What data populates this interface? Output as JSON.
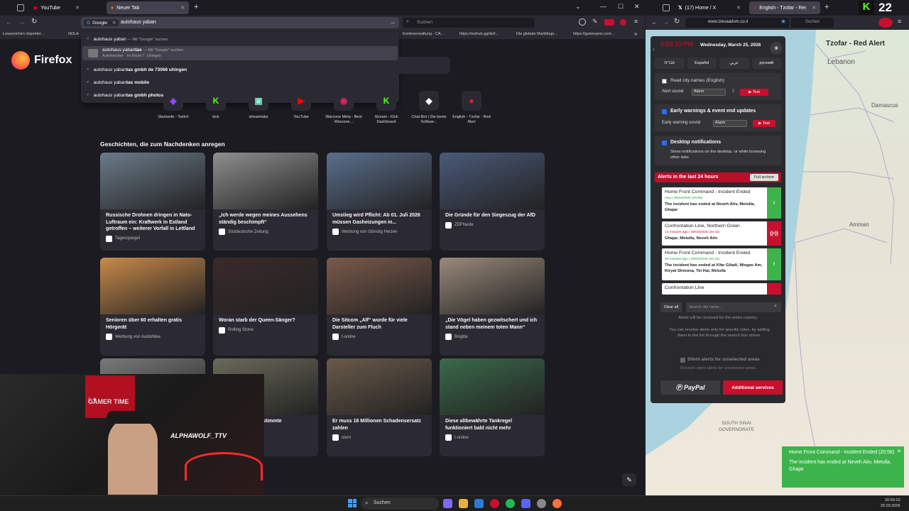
{
  "left_browser": {
    "tabs": [
      {
        "label": "YouTube",
        "icon": "youtube-icon"
      },
      {
        "label": "Neuer Tab",
        "icon": "firefox-tab-icon"
      }
    ],
    "address": {
      "engine": "Google",
      "value": "autohaus yaban"
    },
    "search_placeholder": "Suchen",
    "bookmarks": [
      "Lesezeichen importier...",
      "NOLA",
      "Kontoverwaltung - CA...",
      "https://wzhub.gg/de/l...",
      "Die globale Marktkapi...",
      "https://gamevpns.com..."
    ],
    "suggestions": [
      {
        "pre": "autohaus yaban",
        "bold": "",
        "suffix": " — Mit \"Google\" suchen",
        "sub": ""
      },
      {
        "pre": "autohaus yaban",
        "bold": "tas",
        "suffix": " — Mit \"Google\" suchen",
        "sub": "Autohändler · Im Brühl 7, Uhingen"
      },
      {
        "pre": "autohaus yaban",
        "bold": "tas gmbh de 73066 uhingen",
        "suffix": "",
        "sub": ""
      },
      {
        "pre": "autohaus yaban",
        "bold": "tas mobile",
        "suffix": "",
        "sub": ""
      },
      {
        "pre": "autohaus yaban",
        "bold": "tas gmbh photos",
        "suffix": "",
        "sub": ""
      }
    ],
    "brand": "Firefox",
    "shortcuts": [
      {
        "label": "Startseite - Twitch",
        "glyph": "◆",
        "color": "#9146ff"
      },
      {
        "label": "kick",
        "glyph": "K",
        "color": "#53fc18"
      },
      {
        "label": "streamlabs",
        "glyph": "▣",
        "color": "#80f5d2"
      },
      {
        "label": "YouTube",
        "glyph": "▶",
        "color": "#ff0000"
      },
      {
        "label": "Warzone Meta - Best Warzone...",
        "glyph": "◉",
        "color": "#e0245e"
      },
      {
        "label": "Stream - Kick Dashboard",
        "glyph": "K",
        "color": "#53fc18"
      },
      {
        "label": "Chat-Bot | Die beste Softwar...",
        "glyph": "◆",
        "color": "#ffffff"
      },
      {
        "label": "English - Tzofar - Red Alert",
        "glyph": "●",
        "color": "#e0202a"
      }
    ],
    "stories_heading": "Geschichten, die zum Nachdenken anregen",
    "stories": [
      {
        "title": "Russische Drohnen dringen in Nato-Luftraum ein: Kraftwerk in Estland getroffen – weiterer Vorfall in Lettland",
        "source": "Tagesspiegel",
        "color": "#6b7b8a"
      },
      {
        "title": "„Ich werde wegen meines Aussehens ständig beschimpft“",
        "source": "Süddeutsche Zeitung",
        "color": "#8f8f8f"
      },
      {
        "title": "Umstieg wird Pflicht: Ab 01. Juli 2026 müssen Gasheizungen in...",
        "source": "Werbung von Günstig Heizen",
        "color": "#5a6f8c"
      },
      {
        "title": "Die Gründe für den Siegeszug der AfD",
        "source": "ZDFheute",
        "color": "#4a5a78"
      },
      {
        "title": "Senioren über 60 erhalten gratis Hörgerät",
        "source": "Werbung von AudioMee",
        "color": "#c98a4a"
      },
      {
        "title": "Woran starb der Queen-Sänger?",
        "source": "Rolling Stone",
        "color": "#3a2a2a"
      },
      {
        "title": "Die Sitcom „Alf“ wurde für viele Darsteller zum Fluch",
        "source": "t-online",
        "color": "#7a5a4a"
      },
      {
        "title": "„Die Vögel haben gezwitschert und ich stand neben meinem toten Mann“",
        "source": "Brigitte",
        "color": "#9a8a7a"
      },
      {
        "title": "",
        "source": "",
        "color": "#7a7a7a"
      },
      {
        "title": "kritisiert ...ehen bestimmte",
        "source": "",
        "color": "#6a6a5a"
      },
      {
        "title": "Er muss 16 Millionen Schadensersatz zahlen",
        "source": "stern",
        "color": "#6a5a4a"
      },
      {
        "title": "Diese altbewährte Tankregel funktioniert bald nicht mehr",
        "source": "t-online",
        "color": "#3a6a4a"
      }
    ]
  },
  "right_browser": {
    "tabs": [
      {
        "label": "(17) Home / X",
        "icon": "x-icon"
      },
      {
        "label": "English - Tzofar - Red Alert",
        "icon": "redalert-tab-icon"
      }
    ],
    "url": "www.tzevaadom.co.il",
    "search_placeholder": "Suchen",
    "map_labels": {
      "title": "Tzofar - Red Alert",
      "lebanon": "Lebanon",
      "damascus": "Damascus",
      "amman": "Amman",
      "sinai": "SOUTH SINAI GOVERNORATE"
    },
    "panel": {
      "time": "8:59:10 PM",
      "date": "Wednesday, March 25, 2026",
      "languages": [
        "עברית",
        "Español",
        "عربي",
        "русский"
      ],
      "read_city_names": "Read city names (English)",
      "alert_sound_label": "Alert sound",
      "alert_sound_value": "Alarm",
      "test_label": "Test",
      "early_warnings": "Early warnings & event end updates",
      "early_sound_label": "Early warning sound",
      "early_sound_value": "Alarm",
      "desktop_notif": "Desktop notifications",
      "desktop_notif_sub": "Show notifications on the desktop, or while browsing other tabs",
      "alerts_heading": "Alerts in the last 24 hours",
      "full_archive": "Full archive",
      "alerts": [
        {
          "title": "Home Front Command - Incident Ended",
          "meta": "now | 25/03/2026 (20:58)",
          "body": "The incident has ended at Neveh Ativ, Metulla, Ghajar",
          "color": "#3cb44b",
          "glyph": "!"
        },
        {
          "title": "Confrontation Line, Northern Golan",
          "meta": "14 minutes ago | 25/03/2026 (20:44)",
          "body": "Ghajar, Metulla, Neveh Ativ",
          "color": "#c8102e",
          "glyph": "((•))"
        },
        {
          "title": "Home Front Command - Incident Ended",
          "meta": "16 minutes ago | 25/03/2026 (20:42)",
          "body": "The incident has ended at Kfar Giladi, Misgav Am, Kiryat Shmona, Tel Hai, Metulla",
          "color": "#3cb44b",
          "glyph": "!"
        },
        {
          "title": "Confrontation Line",
          "meta": "",
          "body": "",
          "color": "#c8102e",
          "glyph": ""
        }
      ],
      "clear_all": "Clear all",
      "city_placeholder": "Search city name...",
      "entire_country": "Alerts will be received for the entire country.",
      "specific_cities": "You can receive alerts only for specific cities, by adding them to the list through the search box above.",
      "silent_alerts": "Silent alerts for unselected areas",
      "silent_sub": "Receive silent alerts for unselected areas",
      "paypal": "PayPal",
      "additional": "Additional services"
    },
    "toast": {
      "title": "Home Front Command - Incident Ended (20:58)",
      "body": "The incident has ended at Neveh Ativ, Metulla, Ghajar"
    },
    "kick_count": "22"
  },
  "webcam": {
    "overlay": "ALPHAWOLF_TTV",
    "sign": "GAMER TIME"
  },
  "taskbar": {
    "search": "Suchen",
    "time": "20:59:10",
    "date": "25.03.2026"
  }
}
